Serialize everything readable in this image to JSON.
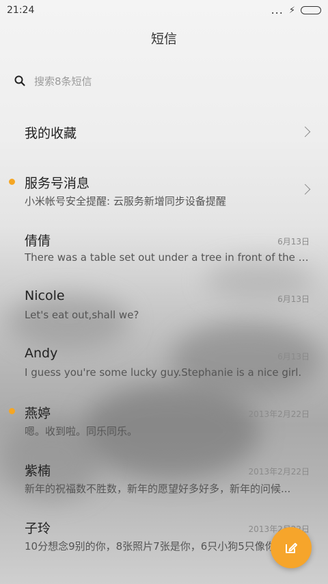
{
  "status_bar": {
    "time": "21:24",
    "signal_glyph": "...",
    "charging_glyph": "⚡"
  },
  "header": {
    "title": "短信"
  },
  "search": {
    "placeholder": "搜索8条短信"
  },
  "favorites": {
    "label": "我的收藏"
  },
  "service": {
    "title": "服务号消息",
    "subtitle": "小米帐号安全提醒: 云服务新增同步设备提醒",
    "unread": true
  },
  "conversations": [
    {
      "name": "倩倩",
      "preview": "There was a table set out under a tree in front of the ho...",
      "date": "6月13日",
      "unread": false
    },
    {
      "name": "Nicole",
      "preview": "Let's eat out,shall we?",
      "date": "6月13日",
      "unread": false
    },
    {
      "name": "Andy",
      "preview": "I guess you're some lucky guy.Stephanie is a nice girl.",
      "date": "6月13日",
      "unread": false
    },
    {
      "name": "燕婷",
      "preview": "嗯。收到啦。同乐同乐。",
      "date": "2013年2月22日",
      "unread": true
    },
    {
      "name": "紫楠",
      "preview": "新年的祝福数不胜数，新年的愿望好多好多，新年的问候...",
      "date": "2013年2月22日",
      "unread": false
    },
    {
      "name": "子玲",
      "preview": "10分想念9别的你，8张照片7张是你，6只小狗5只像你",
      "date": "2013年2月22日",
      "unread": false
    }
  ],
  "colors": {
    "accent": "#f6a52b",
    "unread_dot": "#f5a623"
  },
  "icons": {
    "search": "search-icon",
    "compose": "compose-icon",
    "chevron": "chevron-right-icon"
  }
}
